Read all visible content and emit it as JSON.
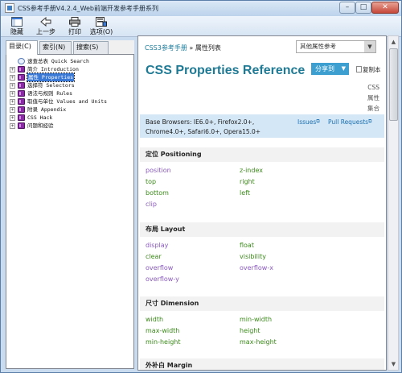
{
  "window": {
    "title": "CSS参考手册V4.2.4_Web前端开发参考手册系列",
    "minimize_glyph": "–",
    "maximize_glyph": "□",
    "close_glyph": "✕"
  },
  "toolbar": {
    "hide_label": "隐藏",
    "back_label": "上一步",
    "print_label": "打印",
    "options_label": "选项(O)"
  },
  "left_pane": {
    "tabs": [
      "目录(C)",
      "索引(N)",
      "搜索(S)"
    ],
    "tree": [
      {
        "label": "速查总表 Quick Search",
        "icon": "page-icon",
        "expand": ""
      },
      {
        "label": "简介 Introduction",
        "icon": "book-icon",
        "expand": "+"
      },
      {
        "label": "属性 Properties",
        "icon": "book-icon",
        "expand": "+",
        "selected": true
      },
      {
        "label": "选择符 Selectors",
        "icon": "book-icon",
        "expand": "+"
      },
      {
        "label": "语法与规则 Rules",
        "icon": "book-icon",
        "expand": "+"
      },
      {
        "label": "取值与单位 Values and Units",
        "icon": "book-icon",
        "expand": "+"
      },
      {
        "label": "附录 Appendix",
        "icon": "book-icon",
        "expand": "+"
      },
      {
        "label": "CSS Hack",
        "icon": "book-icon",
        "expand": "+"
      },
      {
        "label": "问题和经验",
        "icon": "book-icon",
        "expand": "+"
      }
    ]
  },
  "content": {
    "breadcrumb_link": "CSS3参考手册",
    "breadcrumb_sep": " » ",
    "breadcrumb_current": "属性列表",
    "other_select_value": "其他属性参考",
    "title": "CSS Properties Reference",
    "share_label": "分享到",
    "copy_label": "复制本",
    "css_set_lines": [
      "CSS",
      "属性",
      "集合"
    ],
    "browser_lines": [
      "Base Browsers: IE6.0+, Firefox2.0+,",
      "Chrome4.0+, Safari6.0+, Opera15.0+"
    ],
    "issues_label": "Issues",
    "pr_label": "Pull Requests",
    "sections": [
      {
        "title": "定位 Positioning",
        "col1": [
          "position",
          "top",
          "bottom",
          "clip"
        ],
        "col2": [
          "z-index",
          "right",
          "left"
        ],
        "col1_colors": [
          "purple",
          "green",
          "green",
          "purple"
        ],
        "col2_colors": [
          "green",
          "green",
          "green"
        ]
      },
      {
        "title": "布局 Layout",
        "col1": [
          "display",
          "clear",
          "overflow",
          "overflow-y"
        ],
        "col2": [
          "float",
          "visibility",
          "overflow-x"
        ],
        "col1_colors": [
          "purple",
          "green",
          "purple",
          "purple"
        ],
        "col2_colors": [
          "green",
          "green",
          "purple"
        ]
      },
      {
        "title": "尺寸 Dimension",
        "col1": [
          "width",
          "max-width",
          "min-height"
        ],
        "col2": [
          "min-width",
          "height",
          "max-height"
        ],
        "col1_colors": [
          "green",
          "green",
          "green"
        ],
        "col2_colors": [
          "green",
          "green",
          "green"
        ]
      },
      {
        "title": "外补白 Margin",
        "col1": [],
        "col2": []
      }
    ]
  }
}
